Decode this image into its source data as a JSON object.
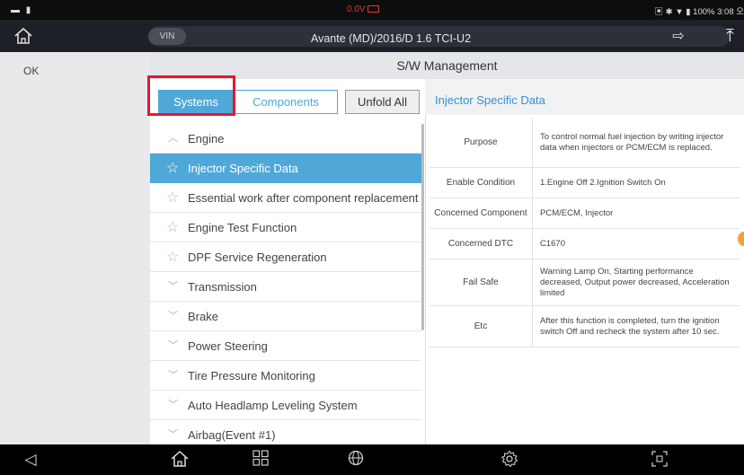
{
  "status_bar": {
    "left_icons": "▬ ▮",
    "voltage": "0.0V",
    "right": "▣ ✱ ▼ ▮ 100% 3:08 오"
  },
  "vehicle_bar": {
    "vin_label": "VIN",
    "title": "Avante (MD)/2016/D 1.6 TCI-U2"
  },
  "left_column": {
    "ok_label": "OK"
  },
  "page_title": "S/W Management",
  "tabs": {
    "systems": "Systems",
    "components": "Components",
    "unfold_all": "Unfold All"
  },
  "list": [
    {
      "type": "category",
      "label": "Engine",
      "expanded": true
    },
    {
      "type": "item",
      "label": "Injector Specific Data",
      "selected": true
    },
    {
      "type": "item",
      "label": "Essential work after component replacement"
    },
    {
      "type": "item",
      "label": "Engine Test Function"
    },
    {
      "type": "item",
      "label": "DPF Service Regeneration"
    },
    {
      "type": "category",
      "label": "Transmission"
    },
    {
      "type": "category",
      "label": "Brake"
    },
    {
      "type": "category",
      "label": "Power Steering"
    },
    {
      "type": "category",
      "label": "Tire Pressure Monitoring"
    },
    {
      "type": "category",
      "label": "Auto Headlamp Leveling System"
    },
    {
      "type": "category",
      "label": "Airbag(Event #1)"
    }
  ],
  "detail": {
    "title": "Injector Specific Data",
    "rows": [
      {
        "key": "Purpose",
        "value": "To control normal fuel injection by writing injector data when injectors or PCM/ECM is replaced."
      },
      {
        "key": "Enable Condition",
        "value": "1.Engine Off 2.Ignition Switch On"
      },
      {
        "key": "Concerned Component",
        "value": "PCM/ECM, Injector"
      },
      {
        "key": "Concerned DTC",
        "value": "C1670"
      },
      {
        "key": "Fail Safe",
        "value": "Warning Lamp On, Starting performance decreased, Output power decreased, Acceleration limited"
      },
      {
        "key": "Etc",
        "value": "After this function is completed, turn the ignition switch Off and recheck the system after 10 sec."
      }
    ]
  },
  "colors": {
    "accent": "#4fa8d8",
    "highlight_box": "#e8172c",
    "header_dark": "#1d2027"
  },
  "nav_icons": [
    "back-icon",
    "home-icon",
    "grid-icon",
    "globe-icon",
    "settings-icon",
    "screenshot-icon"
  ]
}
